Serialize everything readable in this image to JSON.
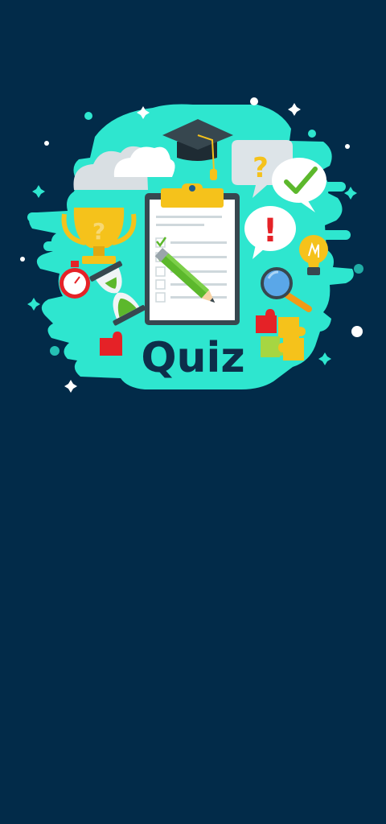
{
  "splash": {
    "title": "Quiz",
    "illustration": "quiz-splash-illustration",
    "trophy_glyph": "?",
    "bubble_question_glyph": "?",
    "bubble_exclaim_glyph": "!"
  },
  "colors": {
    "background": "#022b49",
    "splash_teal": "#2ee6cf",
    "title_navy": "#0d2e4a",
    "gold": "#f5c21b",
    "green_check": "#5cb82c",
    "red": "#e52227"
  },
  "icons": [
    "graduation-cap-icon",
    "cloud-icon",
    "speech-bubble-question-icon",
    "speech-bubble-check-icon",
    "speech-bubble-exclamation-icon",
    "trophy-icon",
    "stopwatch-icon",
    "hourglass-icon",
    "clipboard-checklist-icon",
    "pencil-icon",
    "magnifier-icon",
    "lightbulb-icon",
    "puzzle-piece-icon"
  ]
}
